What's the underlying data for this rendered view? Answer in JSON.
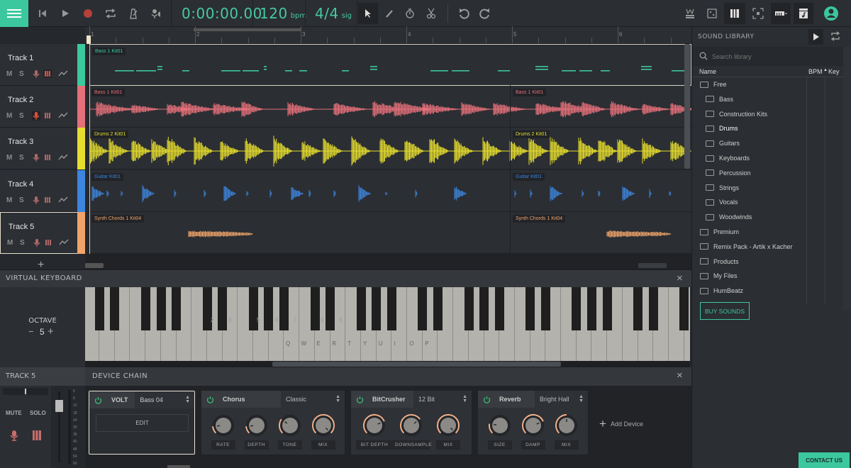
{
  "toolbar": {
    "time": "0:00:00.00",
    "bpm_value": "120",
    "bpm_unit": "bpm",
    "sig_value": "4/4",
    "sig_unit": "sig",
    "accent_color": "#3cc89e",
    "record_color": "#b7413a",
    "transport_icons": [
      "skip-to-start-icon",
      "play-icon",
      "record-icon",
      "loop-icon",
      "metronome-icon",
      "input-monitor-icon"
    ],
    "tool_icons": [
      "pointer-icon",
      "pencil-icon",
      "timer-icon",
      "scissors-icon"
    ],
    "history_icons": [
      "undo-icon",
      "redo-icon"
    ],
    "view_icons": [
      "mixer-icon",
      "editor-icon",
      "keyboard-view-icon",
      "fx-icon",
      "instrument-rack-icon",
      "sound-library-icon",
      "user-avatar-icon"
    ]
  },
  "ruler": {
    "bars": [
      "1",
      "2",
      "3",
      "4",
      "5",
      "6"
    ]
  },
  "tracks": [
    {
      "name": "Track 1",
      "mute": "M",
      "solo": "S",
      "color": "#3cc89e",
      "clips": [
        {
          "label": "Bass 1 Kit01"
        }
      ]
    },
    {
      "name": "Track 2",
      "mute": "M",
      "solo": "S",
      "color": "#e5707a",
      "clips": [
        {
          "label": "Bass 1 Kit01"
        },
        {
          "label": "Bass 1 Kit01"
        }
      ]
    },
    {
      "name": "Track 3",
      "mute": "M",
      "solo": "S",
      "color": "#e6de2e",
      "clips": [
        {
          "label": "Drums 2 Kit01"
        },
        {
          "label": "Drums 2 Kit01"
        }
      ]
    },
    {
      "name": "Track 4",
      "mute": "M",
      "solo": "S",
      "color": "#3d86e0",
      "clips": [
        {
          "label": "Guitar Kit01"
        },
        {
          "label": "Guitar Kit01"
        }
      ]
    },
    {
      "name": "Track 5",
      "mute": "M",
      "solo": "S",
      "color": "#f0a46a",
      "clips": [
        {
          "label": "Synth Chords 1 Kit04"
        },
        {
          "label": "Synth Chords 1 Kit04"
        }
      ]
    }
  ],
  "add_track": "+",
  "library": {
    "title": "SOUND LIBRARY",
    "search_placeholder": "Search library",
    "col_name": "Name",
    "col_bpm": "BPM",
    "col_key": "Key",
    "items": [
      {
        "label": "Free",
        "level": 0
      },
      {
        "label": "Bass",
        "level": 1
      },
      {
        "label": "Construction Kits",
        "level": 1
      },
      {
        "label": "Drums",
        "level": 1
      },
      {
        "label": "Guitars",
        "level": 1
      },
      {
        "label": "Keyboards",
        "level": 1
      },
      {
        "label": "Percussion",
        "level": 1
      },
      {
        "label": "Strings",
        "level": 1
      },
      {
        "label": "Vocals",
        "level": 1
      },
      {
        "label": "Woodwinds",
        "level": 1
      },
      {
        "label": "Premium",
        "level": 0
      },
      {
        "label": "Remix Pack - Artik x Kacher",
        "level": 0
      },
      {
        "label": "Products",
        "level": 0
      },
      {
        "label": "My Files",
        "level": 0
      },
      {
        "label": "HumBeatz",
        "level": 0
      }
    ],
    "buy_button": "BUY SOUNDS"
  },
  "keyboard": {
    "title": "VIRTUAL KEYBOARD",
    "octave_label": "OCTAVE",
    "octave_value": "5",
    "octave_minus": "−",
    "octave_plus": "+",
    "black_key_labels": [
      "2",
      "3",
      "5",
      "6",
      "7",
      "9",
      "0"
    ],
    "white_key_labels": [
      "Q",
      "W",
      "E",
      "R",
      "T",
      "Y",
      "U",
      "I",
      "O",
      "P"
    ]
  },
  "track_panel": {
    "title": "TRACK 5",
    "mute": "MUTE",
    "solo": "SOLO",
    "meter_scale": [
      "0",
      "6",
      "12",
      "18",
      "24",
      "30",
      "36",
      "42",
      "48",
      "54",
      "60"
    ]
  },
  "device_chain": {
    "title": "DEVICE CHAIN",
    "add_device": "Add Device",
    "devices": [
      {
        "name": "VOLT",
        "preset": "Bass 04",
        "edit": "EDIT"
      },
      {
        "name": "Chorus",
        "preset": "Classic",
        "knobs": [
          {
            "label": "RATE",
            "value": 0.15
          },
          {
            "label": "DEPTH",
            "value": 0.15
          },
          {
            "label": "TONE",
            "value": 0.3
          },
          {
            "label": "MIX",
            "value": 1.0
          }
        ]
      },
      {
        "name": "BitCrusher",
        "preset": "12 Bit",
        "knobs": [
          {
            "label": "BIT DEPTH",
            "value": 0.75
          },
          {
            "label": "DOWNSAMPLE",
            "value": 0.7
          },
          {
            "label": "MIX",
            "value": 1.0
          }
        ]
      },
      {
        "name": "Reverb",
        "preset": "Bright Hall",
        "knobs": [
          {
            "label": "SIZE",
            "value": 0.2
          },
          {
            "label": "DAMP",
            "value": 0.75
          },
          {
            "label": "MIX",
            "value": 0.5
          }
        ]
      }
    ]
  },
  "contact_button": "CONTACT US"
}
